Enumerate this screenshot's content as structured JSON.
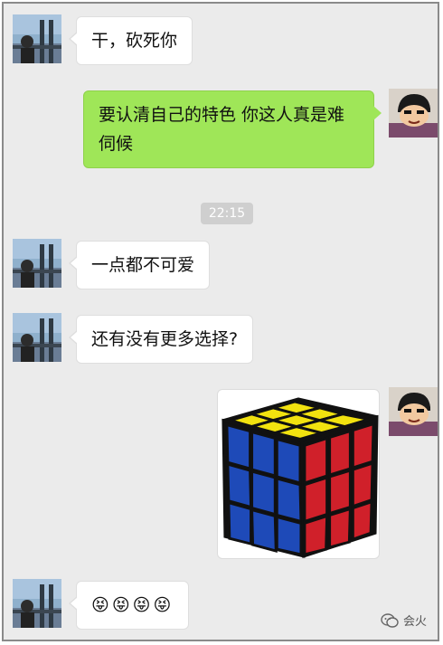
{
  "messages": [
    {
      "side": "in",
      "text": "干，砍死你"
    },
    {
      "side": "out",
      "text": "要认清自己的特色 你这人真是难伺候"
    },
    {
      "side": "in",
      "text": "一点都不可爱"
    },
    {
      "side": "in",
      "text": "还有没有更多选择?"
    },
    {
      "side": "out",
      "image": "rubiks-cube"
    },
    {
      "side": "in",
      "emojis": [
        "😝",
        "😝",
        "😝",
        "😝"
      ]
    }
  ],
  "timestamp": "22:15",
  "watermark": "会火",
  "colors": {
    "chat_bg": "#ebebeb",
    "sent_bubble": "#9fe658",
    "received_bubble": "#ffffff",
    "timestamp_bg": "#cfcfcf"
  },
  "icons": {
    "contact_avatar": "landscape-photo-avatar",
    "self_avatar": "cartoon-boy-avatar",
    "watermark_icon": "wechat-icon"
  }
}
